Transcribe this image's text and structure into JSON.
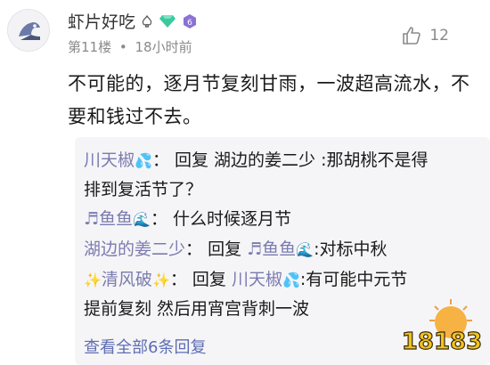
{
  "comment": {
    "username": "虾片好吃",
    "floor": "第11楼",
    "separator": "•",
    "time": "18小时前",
    "like_count": "12",
    "body_lines": [
      "不可能的，逐月节复刻甘雨，一波超高流水，不",
      "要和钱过不去。"
    ]
  },
  "replies": [
    {
      "name": "川天椒",
      "name_emoji": "💦",
      "colon": "：",
      "text_line1": "回复 湖边的姜二少 :那胡桃不是得",
      "text_line2": "排到复活节了？"
    },
    {
      "name_prefix": "♬",
      "name": "鱼鱼",
      "name_emoji": "🌊",
      "colon": "：",
      "text_line1": "什么时候逐月节"
    },
    {
      "name": "湖边的姜二少",
      "colon": "：",
      "text_before": "回复 ",
      "mention_prefix": "♬",
      "mention": "鱼鱼",
      "mention_emoji": "🌊",
      "text_after": ":对标中秋"
    },
    {
      "name_prefix": "✨",
      "name": "清风破",
      "name_emoji": "✨",
      "colon": "：",
      "text_before": "回复 ",
      "mention": "川天椒",
      "mention_emoji": "💦",
      "text_after": ":有可能中元节",
      "text_line2": "提前复刻 然后用宵宫背刺一波"
    }
  ],
  "view_all": "查看全部6条回复",
  "watermark_text": "18183",
  "colors": {
    "reply_name": "#7b7bb0",
    "link": "#5f6db3",
    "meta": "#8a8a8a",
    "reply_bg": "#f5f5f7"
  },
  "icons": [
    "avatar-shark-icon",
    "spade-icon",
    "diamond-badge-icon",
    "level-badge-icon",
    "thumbs-up-icon"
  ]
}
